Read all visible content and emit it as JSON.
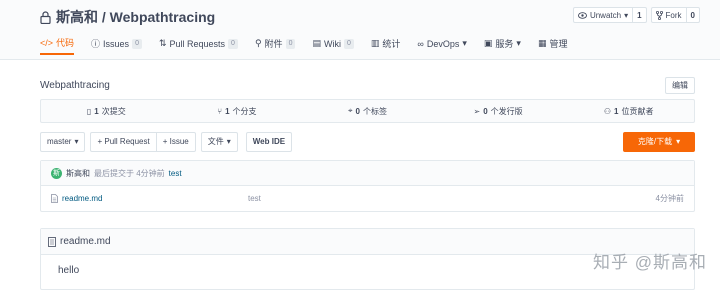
{
  "repo": {
    "title": "斯高和 / Webpathtracing",
    "unwatch_label": "Unwatch",
    "unwatch_count": "1",
    "fork_label": "Fork",
    "fork_count": "0"
  },
  "tabs": [
    {
      "label": "代码",
      "icon": "code-icon",
      "badge": ""
    },
    {
      "label": "Issues",
      "icon": "issue-icon",
      "badge": "0"
    },
    {
      "label": "Pull Requests",
      "icon": "pull-request-icon",
      "badge": "0"
    },
    {
      "label": "附件",
      "icon": "paperclip-icon",
      "badge": "0"
    },
    {
      "label": "Wiki",
      "icon": "book-icon",
      "badge": "0"
    },
    {
      "label": "统计",
      "icon": "bar-chart-icon",
      "badge": ""
    },
    {
      "label": "DevOps",
      "icon": "infinity-icon",
      "badge": ""
    },
    {
      "label": "服务",
      "icon": "briefcase-icon",
      "badge": ""
    },
    {
      "label": "管理",
      "icon": "settings-icon",
      "badge": ""
    }
  ],
  "description": "Webpathtracing",
  "edit_label": "编辑",
  "stats": {
    "commits_num": "1",
    "commits_label": "次提交",
    "branches_num": "1",
    "branches_label": "个分支",
    "tags_num": "0",
    "tags_label": "个标签",
    "releases_num": "0",
    "releases_label": "个发行版",
    "contributors_num": "1",
    "contributors_label": "位贡献者"
  },
  "toolbar": {
    "branch": "master",
    "pull_request": "+ Pull Request",
    "issue": "+ Issue",
    "files": "文件",
    "web_ide": "Web IDE",
    "clone": "克隆/下载"
  },
  "commit": {
    "avatar_letter": "斯",
    "author": "斯高和",
    "meta": "最后提交于 4分钟前",
    "message": "test"
  },
  "files": [
    {
      "name": "readme.md",
      "message": "test",
      "time": "4分钟前"
    }
  ],
  "readme": {
    "title": "readme.md",
    "content": "hello"
  },
  "watermark": "知乎 @斯高和",
  "colors": {
    "accent": "#f76707",
    "link": "#005980",
    "avatar": "#3cb371"
  }
}
